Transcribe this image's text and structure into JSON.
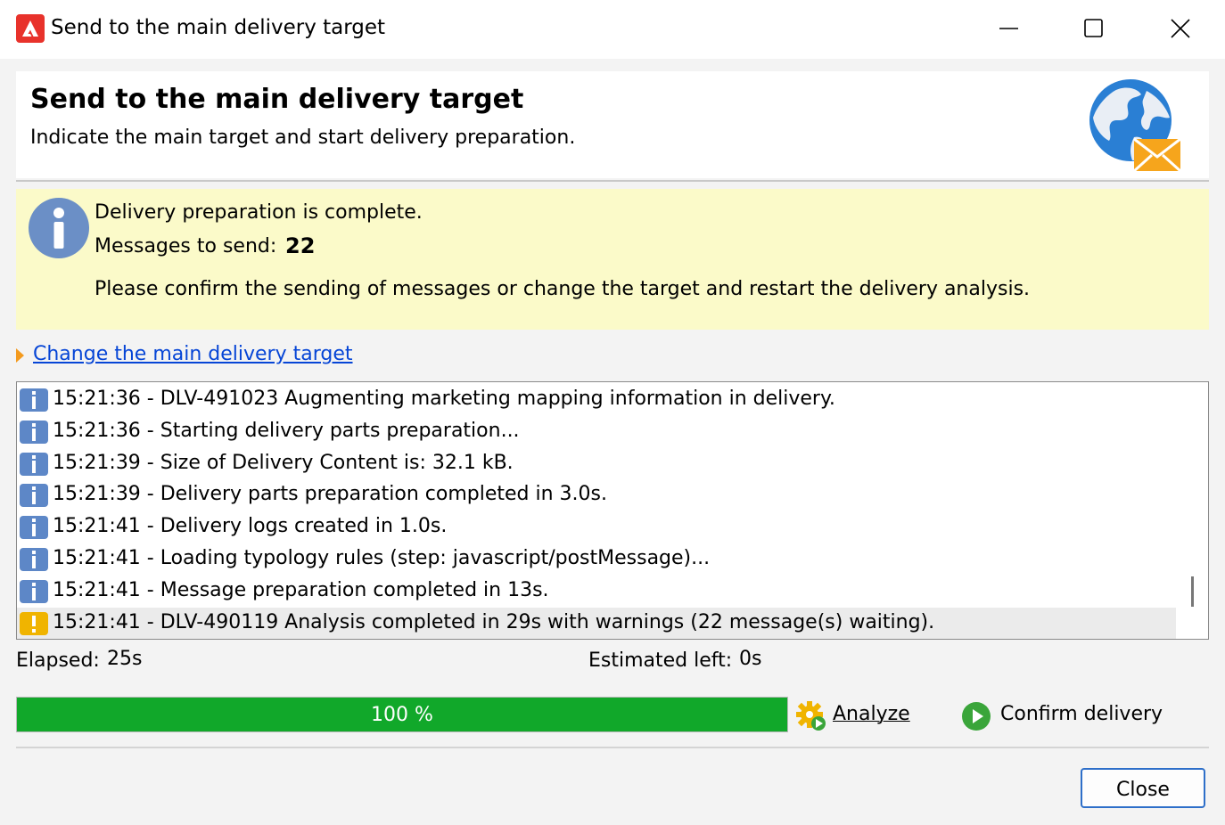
{
  "window": {
    "title": "Send to the main delivery target",
    "app_icon": "adobe-icon",
    "controls": [
      "minimize-icon",
      "maximize-icon",
      "close-icon"
    ]
  },
  "header": {
    "title": "Send to the main delivery target",
    "subtitle": "Indicate the main target and start delivery preparation.",
    "icon": "globe-mail-icon"
  },
  "status": {
    "icon": "info-icon",
    "line1": "Delivery preparation is complete.",
    "messages_label": "Messages to send:",
    "messages_count": "22",
    "line3": "Please confirm the sending of messages or change the target and restart the delivery analysis."
  },
  "change_target_link": "Change the main delivery target",
  "log": [
    {
      "type": "info",
      "text": "15:21:36 - DLV-491023 Augmenting marketing mapping information in delivery."
    },
    {
      "type": "info",
      "text": "15:21:36 - Starting delivery parts preparation..."
    },
    {
      "type": "info",
      "text": "15:21:39 - Size of Delivery Content is: 32.1 kB."
    },
    {
      "type": "info",
      "text": "15:21:39 - Delivery parts preparation completed in 3.0s."
    },
    {
      "type": "info",
      "text": "15:21:41 - Delivery logs created in 1.0s."
    },
    {
      "type": "info",
      "text": "15:21:41 - Loading typology rules (step: javascript/postMessage)..."
    },
    {
      "type": "info",
      "text": "15:21:41 - Message preparation completed in 13s."
    },
    {
      "type": "warning",
      "text": "15:21:41 - DLV-490119 Analysis completed in 29s with warnings (22 message(s) waiting)."
    }
  ],
  "timing": {
    "elapsed_label": "Elapsed:",
    "elapsed_value": "25s",
    "estimated_label": "Estimated left:",
    "estimated_value": "0s"
  },
  "progress": {
    "percent": 100,
    "label": "100 %",
    "color": "#11a82a"
  },
  "actions": {
    "analyze": "Analyze",
    "confirm": "Confirm delivery",
    "close": "Close"
  },
  "colors": {
    "info_bg": "#fbfac9",
    "link": "#0645d6",
    "accent": "#2e6fc9",
    "warning": "#f0b400"
  }
}
